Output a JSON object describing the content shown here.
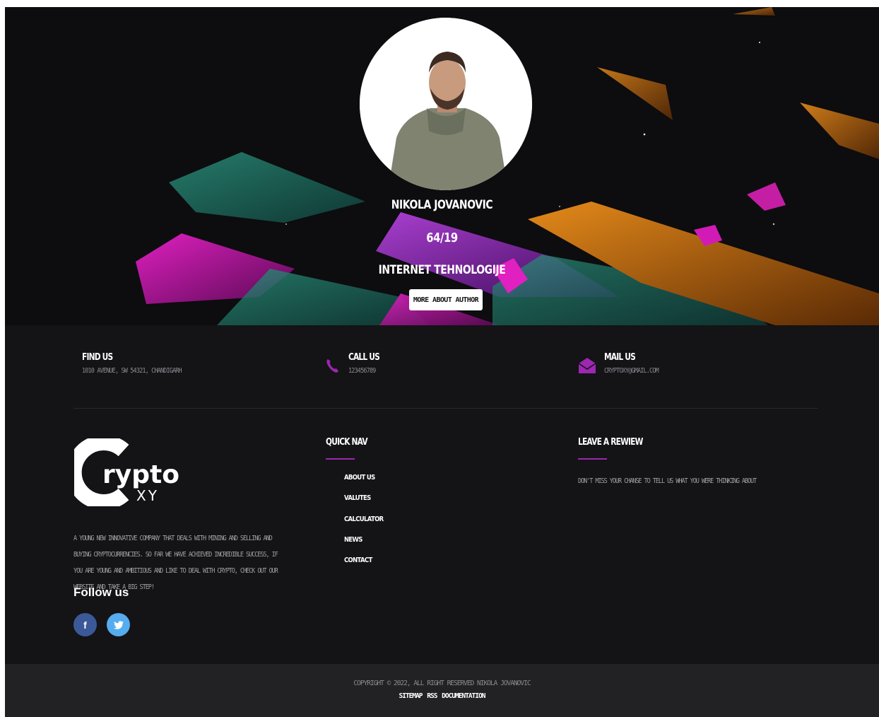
{
  "hero": {
    "author_name": "NIKOLA JOVANOVIC",
    "author_number": "64/19",
    "author_department": "INTERNET TEHNOLOGIJE",
    "more_button_label": "MORE ABOUT AUTHOR"
  },
  "contact": {
    "find": {
      "title": "FIND US",
      "value": "1010 AVENUE, SW 54321, CHANDIGARH",
      "icon": "map-pin-icon"
    },
    "call": {
      "title": "CALL US",
      "value": "123456789",
      "icon": "phone-icon"
    },
    "mail": {
      "title": "MAIL US",
      "value": "CRYPTOXY@GMAIL.COM",
      "icon": "envelope-icon"
    }
  },
  "brand": {
    "logo_letter": "C",
    "logo_main": "rypto",
    "logo_sub": "XY",
    "about": "A YOUNG NEW INNOVATIVE COMPANY THAT DEALS WITH MINING AND SELLING AND BUYING CRYPTOCURRENCIES. SO FAR WE HAVE ACHIEVED INCREDIBLE SUCCESS, IF YOU ARE YOUNG AND AMBITIOUS AND LIKE TO DEAL WITH CRYPTO, CHECK OUT OUR WEBSITE AND TAKE A BIG STEP!",
    "follow_title": "Follow us",
    "social": [
      {
        "name": "facebook",
        "glyph": "f",
        "color": "#3b5998"
      },
      {
        "name": "twitter",
        "glyph": "✔",
        "color": "#55acee"
      }
    ]
  },
  "quick_nav": {
    "title": "QUICK NAV",
    "items": [
      "ABOUT US",
      "VALUTES",
      "CALCULATOR",
      "NEWS",
      "CONTACT"
    ]
  },
  "review": {
    "title": "LEAVE A REWIEW",
    "text": "DON'T MISS YOUR CHANSE TO TELL US WHAT YOU WERE THINKING ABOUT"
  },
  "footer": {
    "copyright": "COPYRIGHT © 2022, ALL RIGHT RESERVED NIKOLA JOVANOVIC",
    "links": [
      "SITEMAP",
      "RSS",
      "DOCUMENTATION"
    ]
  },
  "colors": {
    "accent": "#9c27b0",
    "background": "#141315",
    "footer_bar": "#222124"
  }
}
